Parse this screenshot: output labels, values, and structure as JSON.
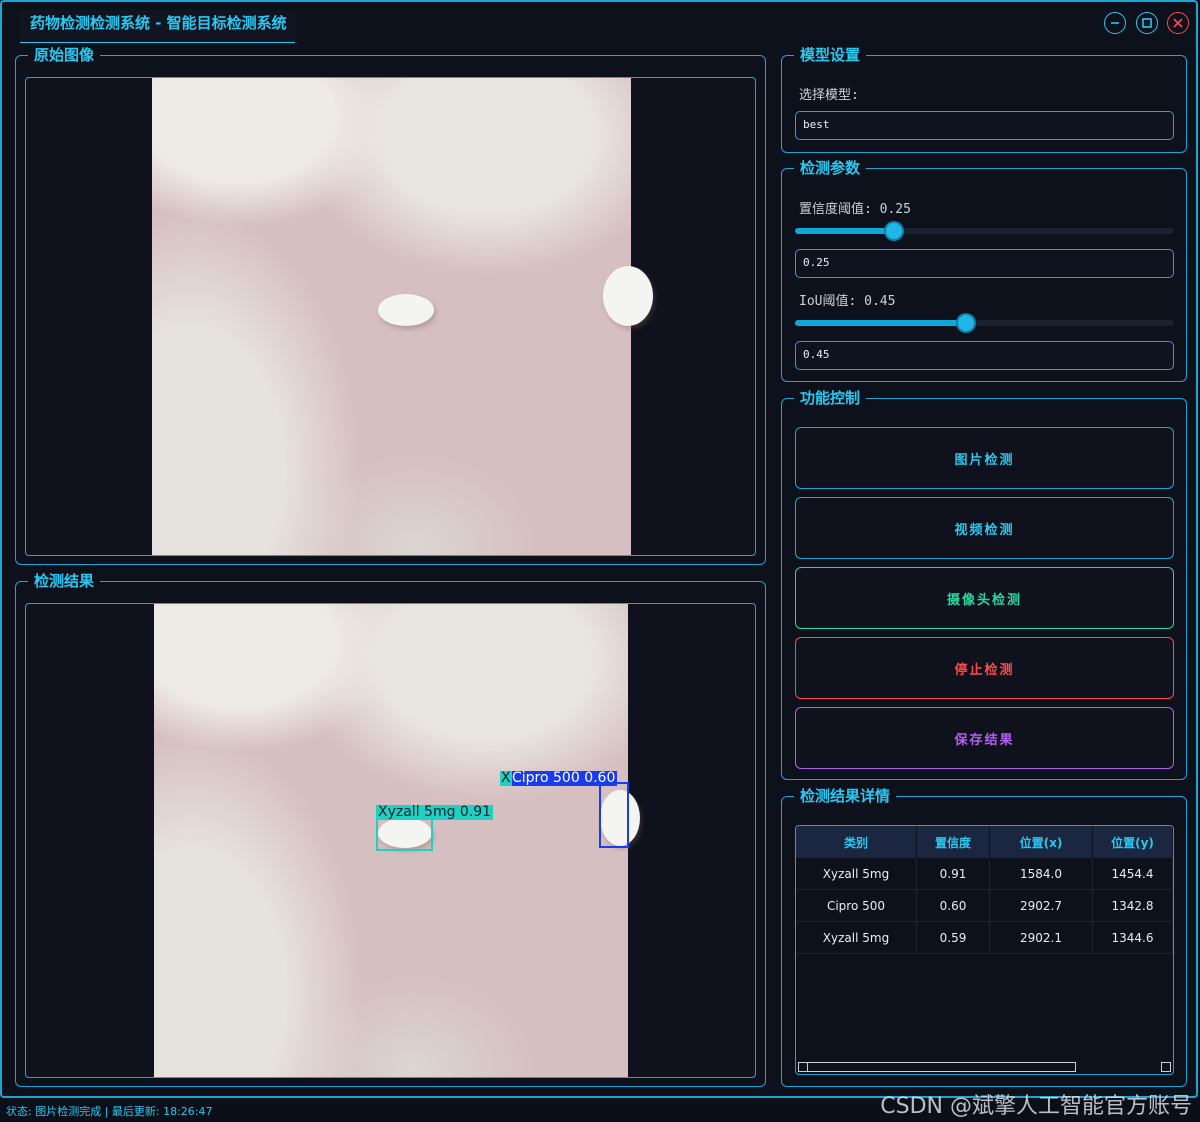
{
  "app": {
    "title": "药物检测检测系统 - 智能目标检测系统"
  },
  "panels": {
    "original_title": "原始图像",
    "result_title": "检测结果",
    "model_title": "模型设置",
    "params_title": "检测参数",
    "control_title": "功能控制",
    "details_title": "检测结果详情"
  },
  "model": {
    "select_label": "选择模型:",
    "selected": "best"
  },
  "params": {
    "conf_label": "置信度阈值: 0.25",
    "conf_value": "0.25",
    "conf_level": 0.25,
    "iou_label": "IoU阈值: 0.45",
    "iou_value": "0.45",
    "iou_level": 0.45
  },
  "controls": {
    "image_detect": "图片检测",
    "video_detect": "视频检测",
    "camera_detect": "摄像头检测",
    "stop_detect": "停止检测",
    "save_result": "保存结果"
  },
  "detections_overlay": [
    {
      "label": "Xyzall 5mg 0.91",
      "color": "#20d0c0"
    },
    {
      "label": "Cipro 500 0.60",
      "color": "#1a3cf0"
    },
    {
      "label": "X",
      "color": "#20d0c0"
    }
  ],
  "table": {
    "headers": [
      "类别",
      "置信度",
      "位置(x)",
      "位置(y)"
    ],
    "rows": [
      [
        "Xyzall 5mg",
        "0.91",
        "1584.0",
        "1454.4"
      ],
      [
        "Cipro 500",
        "0.60",
        "2902.7",
        "1342.8"
      ],
      [
        "Xyzall 5mg",
        "0.59",
        "2902.1",
        "1344.6"
      ]
    ]
  },
  "status": {
    "text": "状态: 图片检测完成 | 最后更新: 18:26:47"
  },
  "watermark": "CSDN @斌擎人工智能官方账号",
  "colors": {
    "accent": "#28c8f0",
    "camera": "#2ad6a0",
    "stop": "#ff4a4a",
    "save": "#b060f0"
  }
}
